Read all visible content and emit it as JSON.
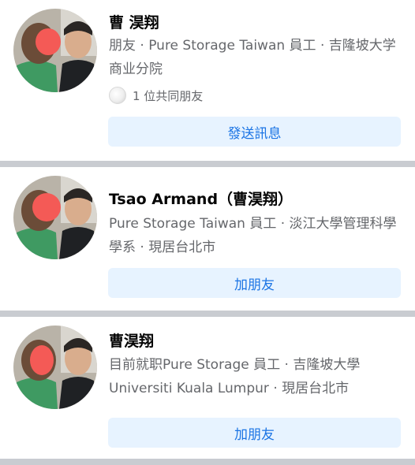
{
  "results": [
    {
      "name": "曹 淏翔",
      "details": "朋友 · Pure Storage Taiwan 員工 · 吉隆坡大学商业分院",
      "mutual_friends": "1 位共同朋友",
      "button_label": "發送訊息"
    },
    {
      "name": "Tsao Armand（曹淏翔）",
      "details": "Pure Storage Taiwan 員工 · 淡江大學管理科學學系 · 現居台北市",
      "button_label": "加朋友"
    },
    {
      "name": "曹淏翔",
      "details": "目前就职Pure Storage 員工 · 吉隆坡大學 Universiti Kuala Lumpur · 現居台北市",
      "button_label": "加朋友"
    }
  ],
  "colors": {
    "button_bg": "#e7f3ff",
    "button_text": "#1b74e4",
    "separator": "#c9ccd1",
    "secondary_text": "#65676b"
  },
  "icons": [
    "profile-photo",
    "mutual-friend-avatar"
  ]
}
